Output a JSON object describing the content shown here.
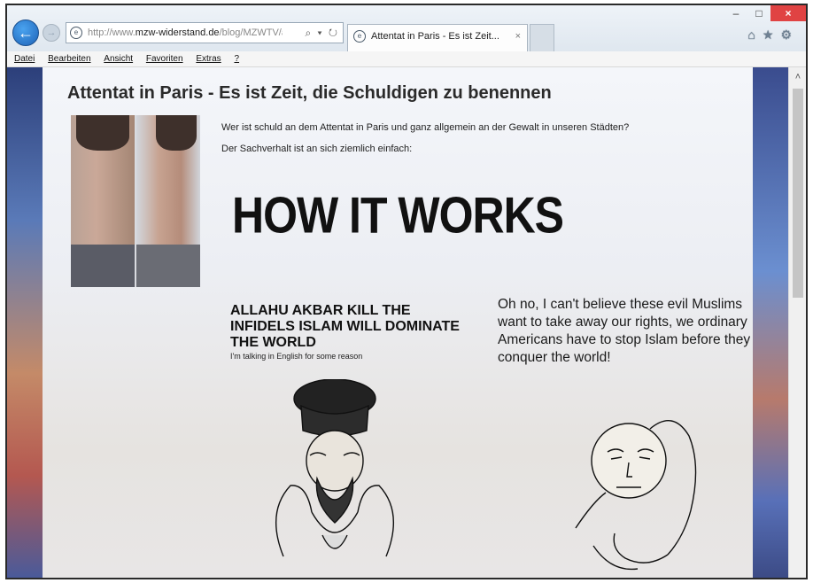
{
  "browser": {
    "url_prefix": "http://www.",
    "url_domain": "mzw-widerstand.de",
    "url_path": "/blog/MZWTV/at",
    "address_tools": "⌕ ▾ ↻",
    "tab_title": "Attentat in Paris - Es ist Zeit...",
    "tab_close": "×",
    "window_controls": {
      "minimize": "–",
      "maximize": "□",
      "close": "×"
    },
    "menu": [
      "Datei",
      "Bearbeiten",
      "Ansicht",
      "Favoriten",
      "Extras",
      "?"
    ]
  },
  "icons": {
    "back": "←",
    "forward": "→",
    "globe": "e",
    "home": "⌂",
    "favorites": "★",
    "settings": "⚙",
    "scroll_up": "˄"
  },
  "article": {
    "title": "Attentat in Paris - Es ist Zeit, die Schuldigen zu benennen",
    "intro_1": "Wer ist schuld an dem Attentat in Paris und ganz allgemein an der Gewalt in unseren Städten?",
    "intro_2": "Der Sachverhalt ist an sich ziemlich einfach:"
  },
  "comic": {
    "headline": "HOW IT WORKS",
    "left_shout": "ALLAHU AKBAR KILL THE INFIDELS ISLAM WILL DOMINATE THE WORLD",
    "left_aside": "I'm talking in English for some reason",
    "right_text": "Oh no, I can't believe these evil Muslims want to take away our rights, we ordinary Americans have to stop Islam before they conquer the world!"
  }
}
